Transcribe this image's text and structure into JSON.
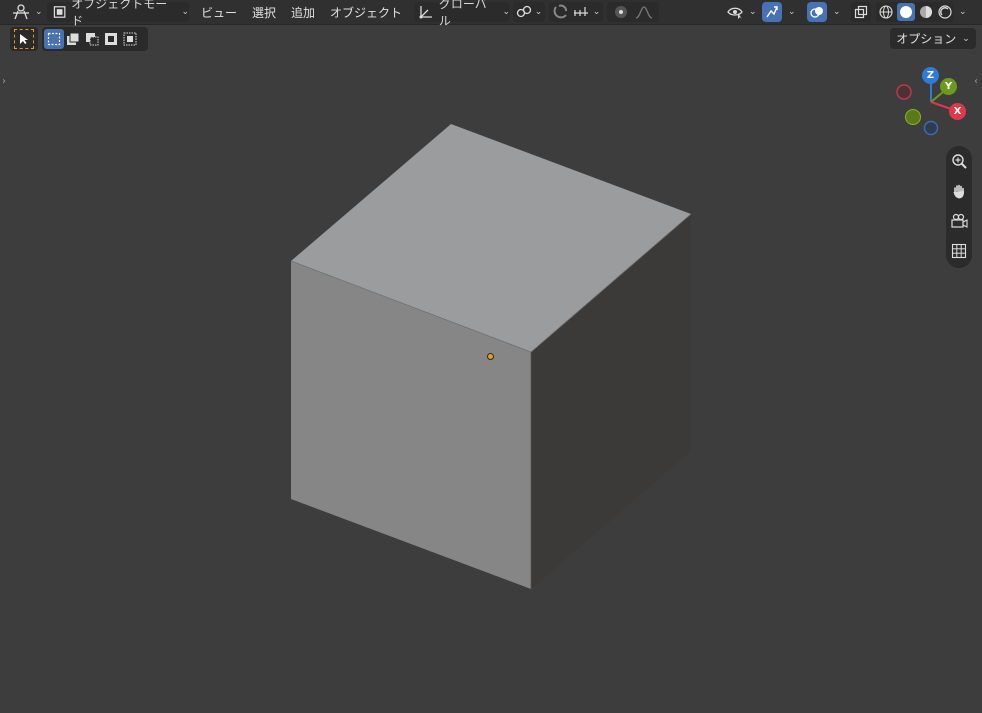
{
  "header": {
    "mode_label": "オブジェクトモード",
    "menus": [
      "ビュー",
      "選択",
      "追加",
      "オブジェクト"
    ],
    "transform_orientation": "グローバル"
  },
  "toolbar": {
    "options_label": "オプション"
  },
  "gizmo": {
    "z_label": "Z",
    "y_label": "Y",
    "x_label": "X",
    "colors": {
      "x": "#e0374b",
      "y": "#6b9a1d",
      "z": "#2f7bd6"
    }
  },
  "scene": {
    "object": "cube",
    "origin_color": "#e89b2c"
  }
}
